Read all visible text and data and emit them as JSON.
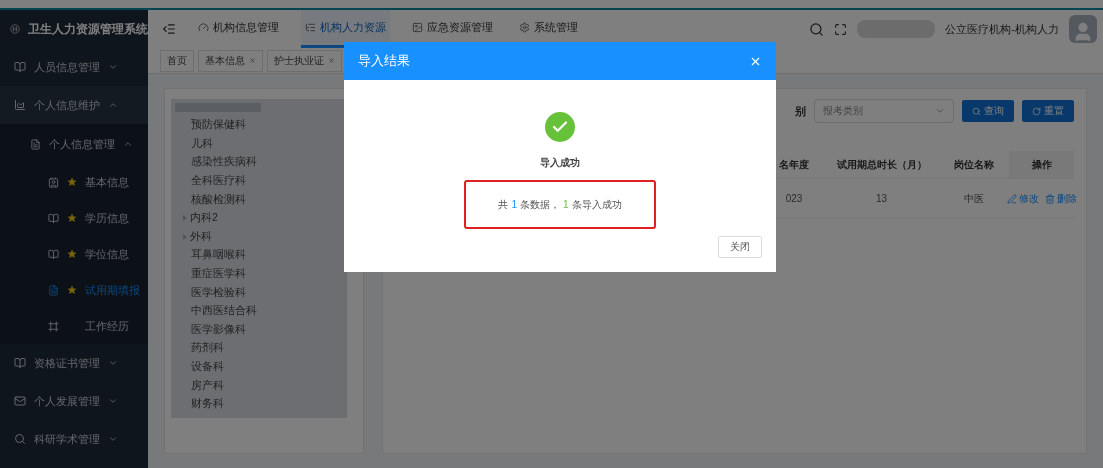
{
  "app": {
    "title": "卫生人力资源管理系统"
  },
  "top_nav": [
    {
      "label": "机构信息管理",
      "selected": false
    },
    {
      "label": "机构人力资源",
      "selected": true
    },
    {
      "label": "应急资源管理",
      "selected": false
    },
    {
      "label": "系统管理",
      "selected": false
    }
  ],
  "user": {
    "role": "公立医疗机构-机构人力"
  },
  "sidebar": {
    "items": [
      {
        "label": "人员信息管理",
        "expanded": false
      },
      {
        "label": "个人信息维护",
        "expanded": true,
        "children": [
          {
            "label": "个人信息管理",
            "expanded": true,
            "children": [
              {
                "label": "基本信息",
                "starred": true,
                "selected": false
              },
              {
                "label": "学历信息",
                "starred": true,
                "selected": false
              },
              {
                "label": "学位信息",
                "starred": true,
                "selected": false
              },
              {
                "label": "试用期填报",
                "starred": true,
                "selected": true
              },
              {
                "label": "工作经历",
                "starred": false,
                "selected": false
              }
            ]
          }
        ]
      },
      {
        "label": "资格证书管理",
        "expanded": false
      },
      {
        "label": "个人发展管理",
        "expanded": false
      },
      {
        "label": "科研学术管理",
        "expanded": false
      }
    ]
  },
  "page_tabs": [
    {
      "label": "首页",
      "closable": false
    },
    {
      "label": "基本信息",
      "closable": true
    },
    {
      "label": "护士执业证",
      "closable": true
    }
  ],
  "department_tree": [
    {
      "label": "预防保健科",
      "expandable": false
    },
    {
      "label": "儿科",
      "expandable": false
    },
    {
      "label": "感染性疾病科",
      "expandable": false
    },
    {
      "label": "全科医疗科",
      "expandable": false
    },
    {
      "label": "核酸检测科",
      "expandable": false
    },
    {
      "label": "内科2",
      "expandable": true
    },
    {
      "label": "外科",
      "expandable": true
    },
    {
      "label": "耳鼻咽喉科",
      "expandable": false
    },
    {
      "label": "重症医学科",
      "expandable": false
    },
    {
      "label": "医学检验科",
      "expandable": false
    },
    {
      "label": "中西医结合科",
      "expandable": false
    },
    {
      "label": "医学影像科",
      "expandable": false
    },
    {
      "label": "药剂科",
      "expandable": false
    },
    {
      "label": "设备科",
      "expandable": false
    },
    {
      "label": "房产科",
      "expandable": false
    },
    {
      "label": "财务科",
      "expandable": false
    }
  ],
  "filter": {
    "label": "别",
    "placeholder": "报考类别",
    "buttons": [
      "查询",
      "重置"
    ]
  },
  "table": {
    "columns": [
      "名年度",
      "试用期总时长（月）",
      "岗位名称",
      "操作"
    ],
    "rows": [
      {
        "cells": [
          "023",
          "13",
          "中医"
        ],
        "actions": [
          "修改",
          "删除"
        ]
      }
    ]
  },
  "dialog": {
    "title": "导入结果",
    "status": "导入成功",
    "summary": {
      "prefix": "共",
      "total": "1",
      "middle": "条数据，",
      "success": "1",
      "suffix": "条导入成功"
    },
    "button": "关闭"
  }
}
